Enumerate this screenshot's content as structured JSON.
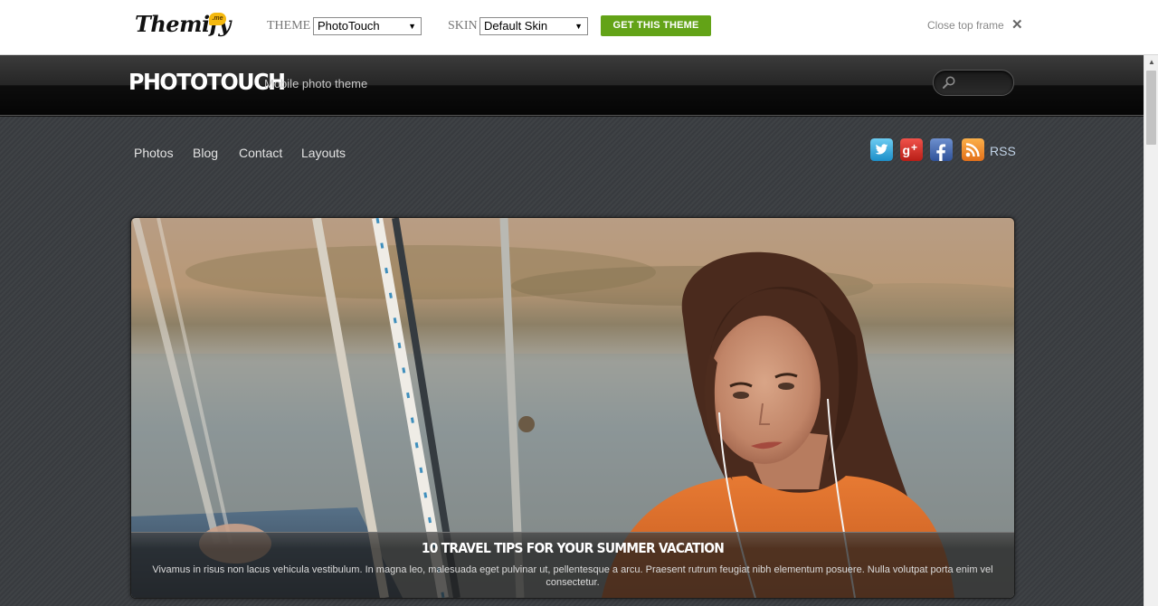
{
  "topframe": {
    "logo_text": "Themify",
    "logo_badge": ".me",
    "theme_label": "THEME",
    "theme_value": "PhotoTouch",
    "skin_label": "SKIN",
    "skin_value": "Default Skin",
    "get_theme_label": "GET THIS THEME",
    "close_label": "Close top frame",
    "close_icon": "close-x-icon",
    "accent_color": "#63a317"
  },
  "site": {
    "title": "PHOTOTOUCH",
    "description": "Mobile photo theme",
    "search_icon": "search-icon",
    "nav": [
      "Photos",
      "Blog",
      "Contact",
      "Layouts"
    ],
    "social_icons": [
      "twitter-icon",
      "google-plus-icon",
      "facebook-icon",
      "rss-icon"
    ],
    "rss_label": "RSS"
  },
  "feature": {
    "title": "10 TRAVEL TIPS FOR YOUR SUMMER VACATION",
    "excerpt": "Vivamus in risus non lacus vehicula vestibulum. In magna leo, malesuada eget pulvinar ut, pellentesque a arcu. Praesent rutrum feugiat nibh elementum posuere. Nulla volutpat porta enim vel consectetur."
  }
}
